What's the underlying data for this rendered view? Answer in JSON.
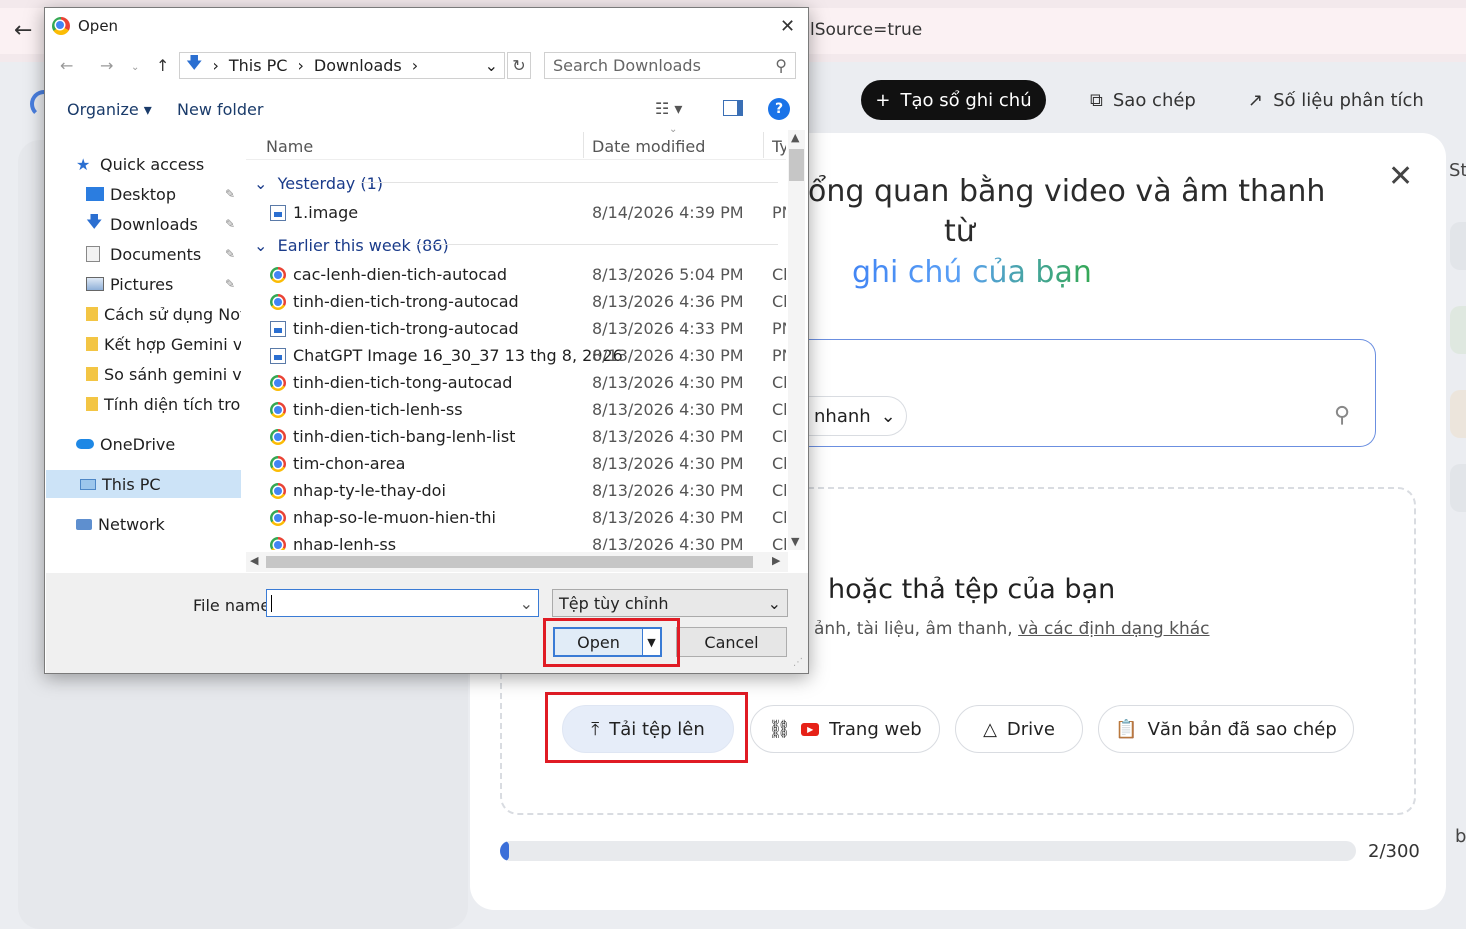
{
  "browser": {
    "url_fragment": "lSource=true"
  },
  "app": {
    "topbar": {
      "create_label": "Tạo sổ ghi chú",
      "copy_label": "Sao chép",
      "analytics_label": "Số liệu phân tích"
    },
    "right_edge_text": "St",
    "right_edge_b": "b"
  },
  "modal": {
    "title_line1": "ổng quan bằng video và âm thanh",
    "title_line2": "từ",
    "title_line3": "ghi chú của bạn",
    "mode_chip_label": "nhanh",
    "drop_title": "hoặc thả tệp của bạn",
    "drop_sub_prefix": "ảnh, tài liệu, âm thanh, ",
    "drop_sub_link": "và các định dạng khác",
    "sources": {
      "upload": "Tải tệp lên",
      "web": "Trang web",
      "drive": "Drive",
      "paste": "Văn bản đã sao chép"
    },
    "progress": {
      "value": 2,
      "max": 300,
      "label": "2/300"
    }
  },
  "dialog": {
    "title": "Open",
    "breadcrumb": [
      "This PC",
      "Downloads"
    ],
    "search_placeholder": "Search Downloads",
    "organize_label": "Organize",
    "new_folder_label": "New folder",
    "nav": [
      {
        "label": "Quick access",
        "icon": "star-icon"
      },
      {
        "label": "Desktop",
        "icon": "desktop-icon",
        "pinned": true
      },
      {
        "label": "Downloads",
        "icon": "download-icon",
        "pinned": true
      },
      {
        "label": "Documents",
        "icon": "documents-icon",
        "pinned": true
      },
      {
        "label": "Pictures",
        "icon": "pictures-icon",
        "pinned": true
      },
      {
        "label": "Cách sử dụng Notet",
        "icon": "folder-icon"
      },
      {
        "label": "Kết hợp Gemini và I",
        "icon": "folder-icon"
      },
      {
        "label": "So sánh gemini vs n",
        "icon": "folder-icon"
      },
      {
        "label": "Tính diện tích trong",
        "icon": "folder-icon"
      },
      {
        "label": "OneDrive",
        "icon": "cloud-icon"
      },
      {
        "label": "This PC",
        "icon": "pc-icon"
      },
      {
        "label": "Network",
        "icon": "network-icon"
      }
    ],
    "columns": {
      "name": "Name",
      "date": "Date modified",
      "type": "Ty"
    },
    "groups": [
      {
        "label": "Yesterday (1)",
        "files": [
          {
            "name": "1.image",
            "date": "8/14/2026 4:39 PM",
            "type": "PN",
            "icon": "png"
          }
        ]
      },
      {
        "label": "Earlier this week (86)",
        "files": [
          {
            "name": "cac-lenh-dien-tich-autocad",
            "date": "8/13/2026 5:04 PM",
            "type": "Ch",
            "icon": "chrome"
          },
          {
            "name": "tinh-dien-tich-trong-autocad",
            "date": "8/13/2026 4:36 PM",
            "type": "Ch",
            "icon": "chrome"
          },
          {
            "name": "tinh-dien-tich-trong-autocad",
            "date": "8/13/2026 4:33 PM",
            "type": "PN",
            "icon": "png"
          },
          {
            "name": "ChatGPT Image 16_30_37 13 thg 8, 2026",
            "date": "8/13/2026 4:30 PM",
            "type": "PN",
            "icon": "png"
          },
          {
            "name": "tinh-dien-tich-tong-autocad",
            "date": "8/13/2026 4:30 PM",
            "type": "Ch",
            "icon": "chrome"
          },
          {
            "name": "tinh-dien-tich-lenh-ss",
            "date": "8/13/2026 4:30 PM",
            "type": "Ch",
            "icon": "chrome"
          },
          {
            "name": "tinh-dien-tich-bang-lenh-list",
            "date": "8/13/2026 4:30 PM",
            "type": "Ch",
            "icon": "chrome"
          },
          {
            "name": "tim-chon-area",
            "date": "8/13/2026 4:30 PM",
            "type": "Ch",
            "icon": "chrome"
          },
          {
            "name": "nhap-ty-le-thay-doi",
            "date": "8/13/2026 4:30 PM",
            "type": "Ch",
            "icon": "chrome"
          },
          {
            "name": "nhap-so-le-muon-hien-thi",
            "date": "8/13/2026 4:30 PM",
            "type": "Ch",
            "icon": "chrome"
          },
          {
            "name": "nhap-lenh-ss",
            "date": "8/13/2026 4:30 PM",
            "type": "Ch",
            "icon": "chrome"
          }
        ]
      }
    ],
    "file_name_label": "File name:",
    "file_name_value": "",
    "file_type_value": "Tệp tùy chỉnh",
    "open_label": "Open",
    "cancel_label": "Cancel"
  },
  "colors": {
    "highlight": "#e01b24",
    "accent": "#1a73e8"
  }
}
